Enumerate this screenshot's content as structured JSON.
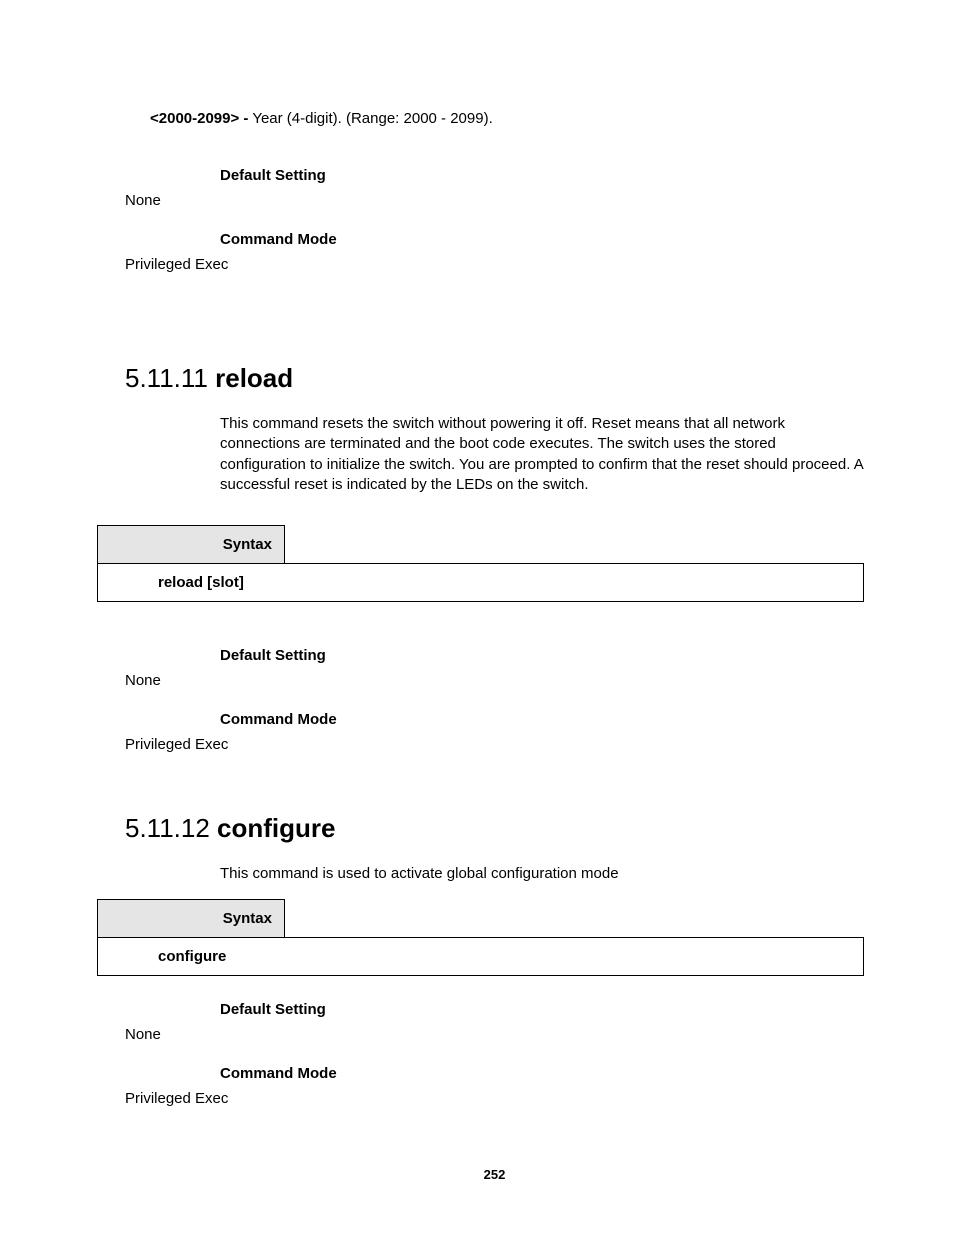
{
  "param": {
    "name": "<2000-2099> -",
    "desc": " Year (4-digit). (Range: 2000 - 2099)."
  },
  "block1": {
    "ds_label": "Default Setting",
    "ds_value": "None",
    "cm_label": "Command Mode",
    "cm_value": "Privileged Exec"
  },
  "sec1": {
    "num": "5.11.11 ",
    "title": "reload",
    "desc": "This command resets the switch without powering it off. Reset means that all network connections are terminated and the boot code executes. The switch uses the stored configuration to initialize the switch. You are prompted to confirm that the reset should proceed. A successful reset is indicated by the LEDs on the switch.",
    "syntax_label": "Syntax",
    "syntax_cmd": "reload [slot]",
    "ds_label": "Default Setting",
    "ds_value": "None",
    "cm_label": "Command Mode",
    "cm_value": "Privileged Exec"
  },
  "sec2": {
    "num": "5.11.12 ",
    "title": "configure",
    "desc": "This command is used to activate global configuration mode",
    "syntax_label": "Syntax",
    "syntax_cmd": "configure",
    "ds_label": "Default Setting",
    "ds_value": "None",
    "cm_label": "Command Mode",
    "cm_value": "Privileged Exec"
  },
  "page_number": "252"
}
